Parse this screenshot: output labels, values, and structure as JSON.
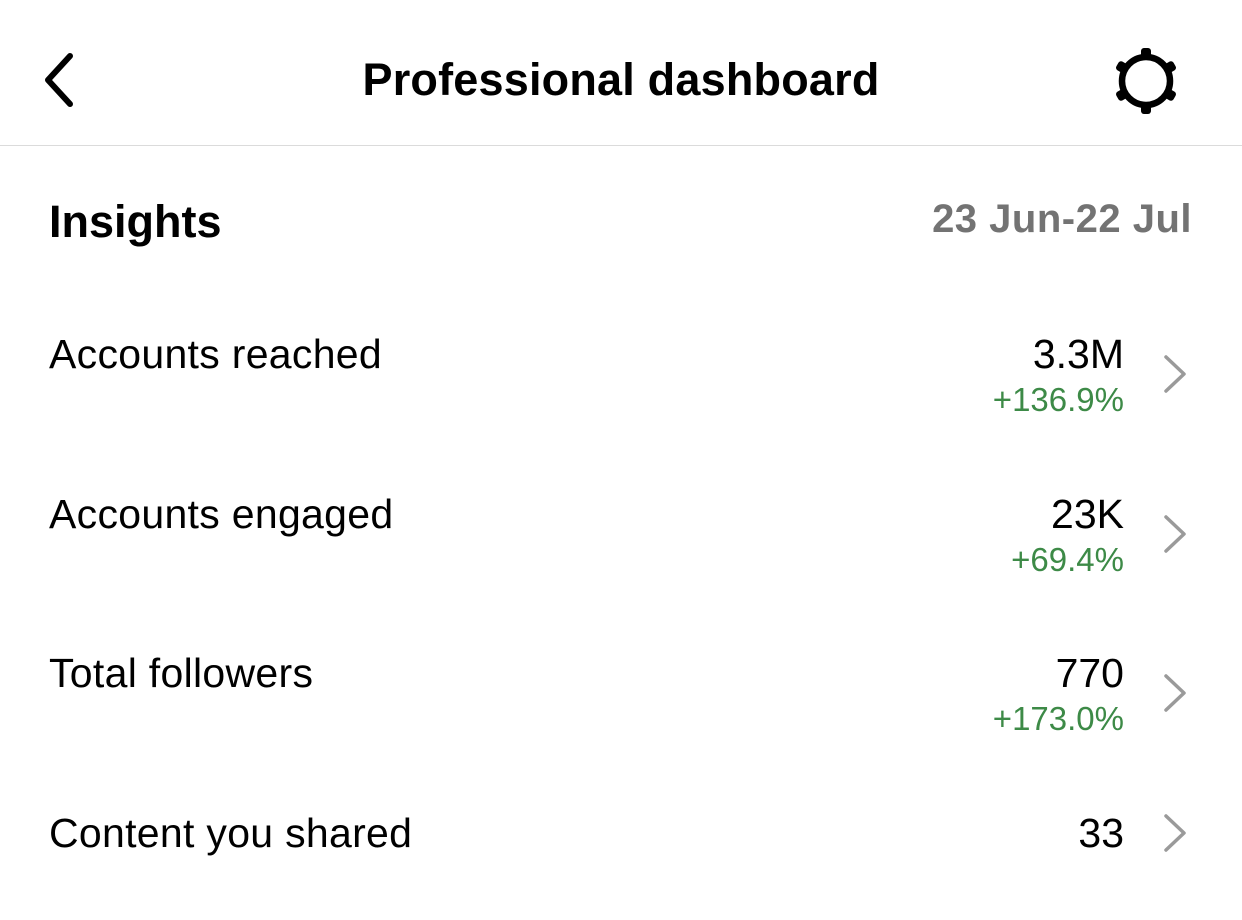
{
  "header": {
    "title": "Professional dashboard",
    "back_icon": "chevron-left-icon",
    "settings_icon": "gear-icon"
  },
  "insights": {
    "title": "Insights",
    "date_range": "23 Jun-22 Jul",
    "metrics": [
      {
        "label": "Accounts reached",
        "value": "3.3M",
        "change": "+136.9%"
      },
      {
        "label": "Accounts engaged",
        "value": "23K",
        "change": "+69.4%"
      },
      {
        "label": "Total followers",
        "value": "770",
        "change": "+173.0%"
      },
      {
        "label": "Content you shared",
        "value": "33",
        "change": ""
      }
    ]
  },
  "colors": {
    "positive": "#3d8a47",
    "muted": "#737373",
    "chevron": "#9a9a9a",
    "divider": "#dbdbdb"
  }
}
